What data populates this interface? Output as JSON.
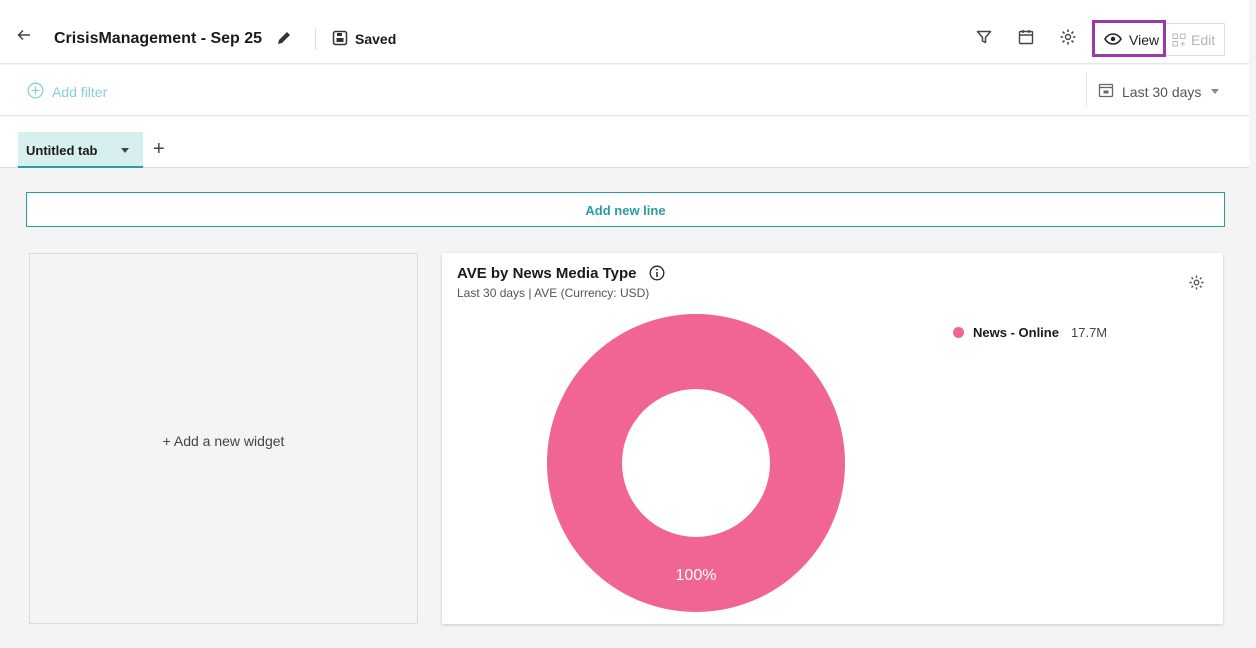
{
  "header": {
    "title": "CrisisManagement - Sep 25",
    "saved_label": "Saved",
    "view_label": "View",
    "edit_label": "Edit"
  },
  "filterbar": {
    "add_filter_label": "Add filter",
    "date_range_label": "Last 30 days"
  },
  "tabs": {
    "items": [
      {
        "label": "Untitled tab"
      }
    ],
    "add_tab_label": "+"
  },
  "main": {
    "add_line_label": "Add new line",
    "add_widget_label": "+ Add a new widget"
  },
  "widget": {
    "title": "AVE by News Media Type",
    "subtitle": "Last 30 days | AVE (Currency: USD)",
    "chart_data": {
      "type": "pie",
      "title": "AVE by News Media Type",
      "series": [
        {
          "name": "News - Online",
          "value": 17.7,
          "value_label": "17.7M",
          "percent_label": "100%",
          "color": "#f06593"
        }
      ]
    }
  },
  "colors": {
    "accent": "#2a9d9e",
    "highlight": "#9b3aa7",
    "donut": "#f06593"
  }
}
